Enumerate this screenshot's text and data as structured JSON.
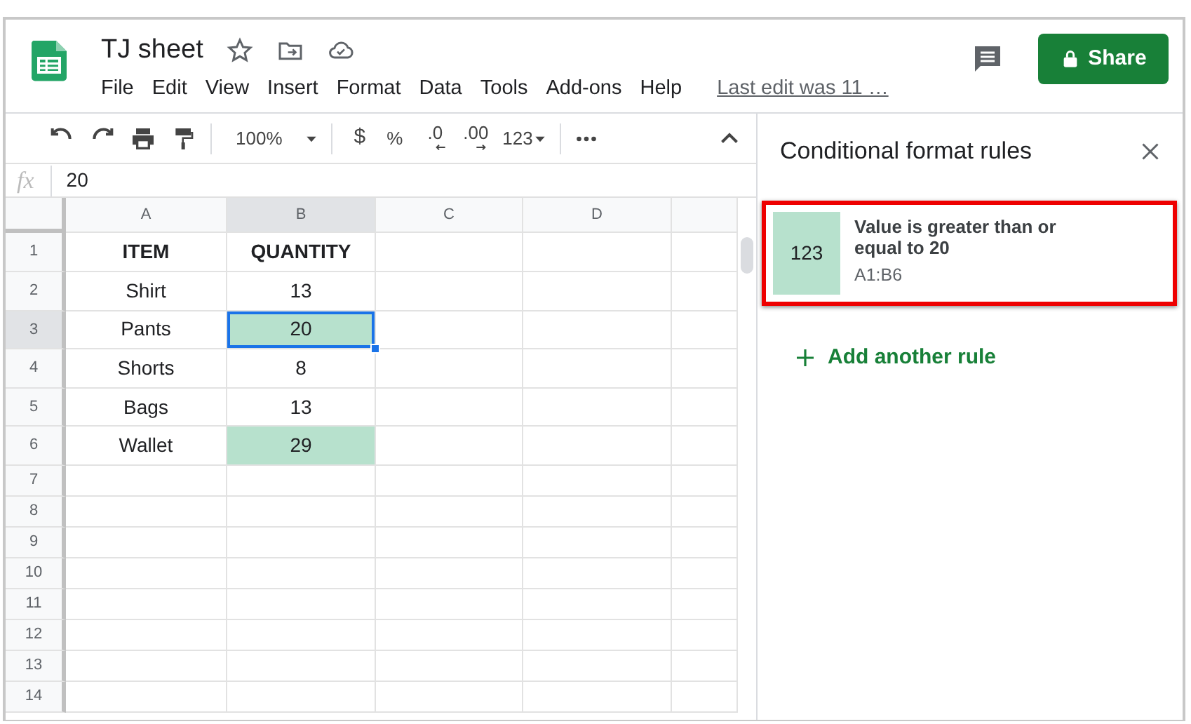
{
  "header": {
    "title": "TJ sheet",
    "menu": [
      "File",
      "Edit",
      "View",
      "Insert",
      "Format",
      "Data",
      "Tools",
      "Add-ons",
      "Help"
    ],
    "last_edit": "Last edit was 11 …",
    "share_button": "Share"
  },
  "toolbar": {
    "zoom": "100%",
    "format_items": [
      {
        "kind": "currency",
        "label": "$"
      },
      {
        "kind": "percent",
        "label": "%"
      },
      {
        "kind": "decrease",
        "label": ".0"
      },
      {
        "kind": "increase",
        "label": ".00"
      },
      {
        "kind": "more",
        "label": "123"
      }
    ]
  },
  "formula_bar": {
    "label": "fx",
    "value": "20"
  },
  "sheet": {
    "columns": [
      {
        "label": "A",
        "selected": false
      },
      {
        "label": "B",
        "selected": true
      },
      {
        "label": "C",
        "selected": false
      },
      {
        "label": "D",
        "selected": false
      },
      {
        "selected": false
      }
    ],
    "rows": [
      {
        "number": "1",
        "selected": false,
        "cells": [
          {
            "text": "ITEM",
            "bold": true,
            "highlighted": false,
            "selected": false
          },
          {
            "text": "QUANTITY",
            "bold": true,
            "highlighted": false,
            "selected": false
          }
        ]
      },
      {
        "number": "2",
        "selected": false,
        "cells": [
          {
            "text": "Shirt",
            "bold": false,
            "highlighted": false,
            "selected": false
          },
          {
            "text": "13",
            "bold": false,
            "highlighted": false,
            "selected": false
          }
        ]
      },
      {
        "number": "3",
        "selected": true,
        "cells": [
          {
            "text": "Pants",
            "bold": false,
            "highlighted": false,
            "selected": false
          },
          {
            "text": "20",
            "bold": false,
            "highlighted": true,
            "selected": true
          }
        ]
      },
      {
        "number": "4",
        "selected": false,
        "cells": [
          {
            "text": "Shorts",
            "bold": false,
            "highlighted": false,
            "selected": false
          },
          {
            "text": "8",
            "bold": false,
            "highlighted": false,
            "selected": false
          }
        ]
      },
      {
        "number": "5",
        "selected": false,
        "cells": [
          {
            "text": "Bags",
            "bold": false,
            "highlighted": false,
            "selected": false
          },
          {
            "text": "13",
            "bold": false,
            "highlighted": false,
            "selected": false
          }
        ]
      },
      {
        "number": "6",
        "selected": false,
        "cells": [
          {
            "text": "Wallet",
            "bold": false,
            "highlighted": false,
            "selected": false
          },
          {
            "text": "29",
            "bold": false,
            "highlighted": true,
            "selected": false
          }
        ]
      },
      {
        "number": "7",
        "selected": false
      },
      {
        "number": "8",
        "selected": false
      },
      {
        "number": "9",
        "selected": false
      },
      {
        "number": "10",
        "selected": false
      },
      {
        "number": "11",
        "selected": false
      },
      {
        "number": "12",
        "selected": false
      },
      {
        "number": "13",
        "selected": false
      },
      {
        "number": "14",
        "selected": false
      }
    ]
  },
  "panel": {
    "title": "Conditional format rules",
    "rules": [
      {
        "preview": "123",
        "description": "Value is greater than or equal to 20",
        "range": "A1:B6",
        "color": "#b7e1cd",
        "marked": true
      }
    ],
    "add_rule": "Add another rule"
  }
}
